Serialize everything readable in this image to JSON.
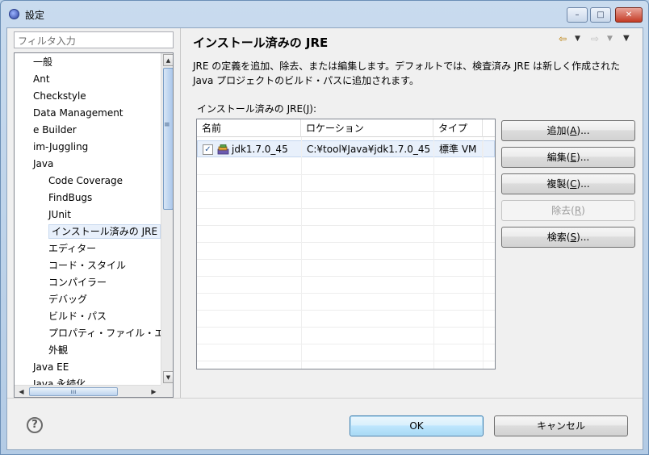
{
  "window": {
    "title": "設定",
    "buttons": {
      "minimize": "–",
      "maximize": "□",
      "close": "✕"
    }
  },
  "sidebar": {
    "filter_placeholder": "フィルタ入力",
    "items": [
      {
        "label": "一般",
        "level": 1
      },
      {
        "label": "Ant",
        "level": 1
      },
      {
        "label": "Checkstyle",
        "level": 1
      },
      {
        "label": "Data Management",
        "level": 1
      },
      {
        "label": "e Builder",
        "level": 1
      },
      {
        "label": "im-Juggling",
        "level": 1
      },
      {
        "label": "Java",
        "level": 1
      },
      {
        "label": "Code Coverage",
        "level": 2
      },
      {
        "label": "FindBugs",
        "level": 2
      },
      {
        "label": "JUnit",
        "level": 2
      },
      {
        "label": "インストール済みの JRE",
        "level": 2,
        "selected": true
      },
      {
        "label": "エディター",
        "level": 2
      },
      {
        "label": "コード・スタイル",
        "level": 2
      },
      {
        "label": "コンパイラー",
        "level": 2
      },
      {
        "label": "デバッグ",
        "level": 2
      },
      {
        "label": "ビルド・パス",
        "level": 2
      },
      {
        "label": "プロパティ・ファイル・エ",
        "level": 2
      },
      {
        "label": "外観",
        "level": 2
      },
      {
        "label": "Java EE",
        "level": 1
      },
      {
        "label": "Java 永続化",
        "level": 1
      }
    ]
  },
  "main": {
    "title": "インストール済みの JRE",
    "description_line1": "JRE の定義を追加、除去、または編集します。デフォルトでは、検査済み JRE は新しく作成された",
    "description_line2": "Java プロジェクトのビルド・パスに追加されます。",
    "list_label_prefix": "インストール済みの JRE(",
    "list_label_mnemonic": "J",
    "list_label_suffix": "):",
    "table": {
      "columns": [
        "名前",
        "ロケーション",
        "タイプ"
      ],
      "rows": [
        {
          "checked": true,
          "name": "jdk1.7.0_45",
          "location": "C:¥tool¥Java¥jdk1.7.0_45",
          "type": "標準 VM"
        }
      ]
    },
    "buttons": {
      "add": {
        "text": "追加(",
        "mn": "A",
        "end": ")..."
      },
      "edit": {
        "text": "編集(",
        "mn": "E",
        "end": ")..."
      },
      "copy": {
        "text": "複製(",
        "mn": "C",
        "end": ")..."
      },
      "remove": {
        "text": "除去(",
        "mn": "R",
        "end": ")"
      },
      "search": {
        "text": "検索(",
        "mn": "S",
        "end": ")..."
      }
    }
  },
  "footer": {
    "help": "?",
    "ok": "OK",
    "cancel": "キャンセル"
  },
  "colors": {
    "accent": "#3c7fb1",
    "selection": "#e8f0fb"
  }
}
